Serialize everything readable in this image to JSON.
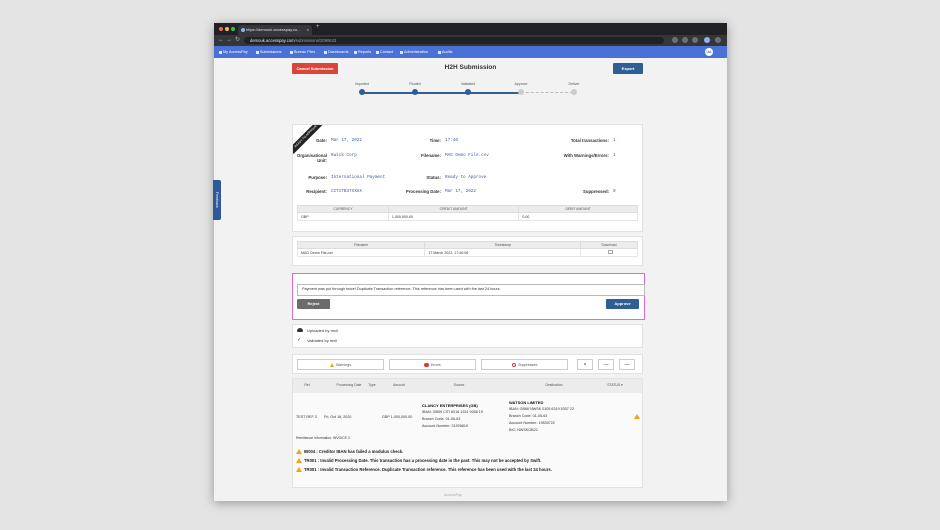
{
  "browser": {
    "tab_title": "https://demouk.accesspay.co...",
    "tab_close": "×",
    "new_tab": "+",
    "url_host": "demouk.accesspay.com",
    "url_path": "/submissions/2090633",
    "nav_back": "←",
    "nav_forward": "→",
    "nav_reload": "↻"
  },
  "appnav": {
    "items": [
      {
        "label": "My AccessPay"
      },
      {
        "label": "Submissions"
      },
      {
        "label": "Bureau Files"
      },
      {
        "label": "Dashboards"
      },
      {
        "label": "Reports"
      },
      {
        "label": "Contact"
      },
      {
        "label": "Administration"
      },
      {
        "label": "Audits"
      }
    ],
    "avatar": "UA"
  },
  "feedback": "Feedback",
  "header": {
    "cancel_label": "Cancel Submission",
    "title": "H2H Submission",
    "export_label": "Export",
    "cancel_color": "#d9443b",
    "export_color": "#2f5e94"
  },
  "steps": [
    {
      "label": "Imported",
      "done": true
    },
    {
      "label": "Routed",
      "done": true
    },
    {
      "label": "Validated",
      "done": true
    },
    {
      "label": "Approve",
      "done": false
    },
    {
      "label": "Deliver",
      "done": false
    }
  ],
  "summary": {
    "ribbon": "READY TO APPROVE",
    "date_label": "Date:",
    "date": "Mar 17, 2022",
    "time_label": "Time:",
    "time": "17:40",
    "total_label": "Total transactions:",
    "total": "1",
    "org_label": "Organisational Unit:",
    "org": "Kwick Corp",
    "filename_label": "Filename:",
    "filename": "MAG Demo File.csv",
    "warnings_label": "With Warnings/Errors:",
    "warnings": "1",
    "purpose_label": "Purpose:",
    "purpose": "International Payment",
    "status_label": "Status:",
    "status": "Ready to Approve",
    "recipient_label": "Recipient:",
    "recipient": "CITITB37XXXX",
    "processing_label": "Processing Date:",
    "processing": "Mar 17, 2022",
    "suppressed_label": "Suppressed:",
    "suppressed": "0",
    "currency_headers": [
      "CURRENCY",
      "CREDIT AMOUNT",
      "DEBIT AMOUNT"
    ],
    "currency_row": [
      "GBP",
      "1,000,000.00",
      "0.00"
    ]
  },
  "files": {
    "headers": [
      "Filename",
      "Timestamp",
      "Download"
    ],
    "row": [
      "MAG Demo File.csv",
      "17 March 2022, 17:40:06"
    ]
  },
  "approval": {
    "note": "Payment was put through twice! Duplicate Transaction reference. This reference has been used with the last 24 hours.",
    "reject_label": "Reject",
    "approve_label": "Approve"
  },
  "history": {
    "uploaded": "Uploaded by mxll",
    "validated": "Validated by mxll"
  },
  "filters": {
    "warnings": "Warnings",
    "errors": "Errors",
    "suppressed": "Suppressed",
    "clear": "×",
    "collapse": "—",
    "expand": "—"
  },
  "transactions": {
    "headers": [
      "Ref",
      "Processing Date",
      "Type",
      "Amount",
      "Source",
      "Destination",
      "STATUS"
    ],
    "row": {
      "ref": "TEST REF 3",
      "date": "Fri, Oct 16, 2020",
      "amount": "GBP 1,000,000.00",
      "source_name": "CLANCY ENTERPRISES (GB)",
      "source_iban": "IBAN: GB09 CITI 6016 1331 9288 19",
      "source_branch": "Branch Code: 01-06-63",
      "source_account": "Account Number: 31926819",
      "dest_name": "WATSON LIMITED",
      "dest_iban": "IBAN: GB66 NWSK 0105 6319 5307 22",
      "dest_branch": "Branch Code: 01-05-63",
      "dest_account": "Account Number: 19530722",
      "dest_bic": "BIC: NWSKGB22",
      "remittance": "Remittance Information: INVOICE 3"
    },
    "messages": [
      "IB004 : Creditor IBAN has failed a modulus check.",
      "TR001 : Invalid Processing Date. This transaction has a processing date in the past. This may not be accepted by Swift.",
      "TR001 : Invalid Transaction Reference. Duplicate Transaction reference. This reference has been used with the last 24 hours."
    ]
  },
  "footer": "AccessPay"
}
